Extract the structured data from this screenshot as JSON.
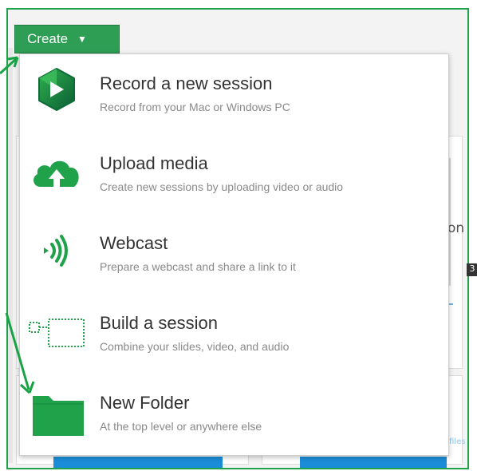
{
  "create_button": {
    "label": "Create",
    "chevron": "▼"
  },
  "menu": {
    "items": [
      {
        "title": "Record a new session",
        "subtitle": "Record from your Mac or Windows PC",
        "icon": "panopto-record-icon"
      },
      {
        "title": "Upload media",
        "subtitle": "Create new sessions by uploading video or audio",
        "icon": "cloud-upload-icon"
      },
      {
        "title": "Webcast",
        "subtitle": "Prepare a webcast and share a link to it",
        "icon": "webcast-icon"
      },
      {
        "title": "Build a session",
        "subtitle": "Combine your slides, video, and audio",
        "icon": "build-session-icon"
      },
      {
        "title": "New Folder",
        "subtitle": "At the top level or anywhere else",
        "icon": "folder-icon"
      }
    ]
  },
  "background": {
    "partial_text": "on",
    "badge_text": "3",
    "partial_label": "files"
  },
  "colors": {
    "accent": "#2e9e55",
    "icon_green": "#1fa24a",
    "arrow": "#17a344"
  }
}
